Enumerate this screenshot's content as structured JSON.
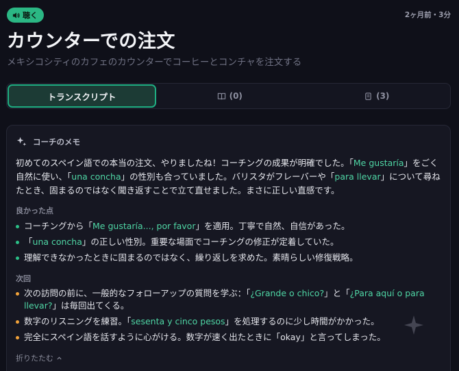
{
  "header": {
    "listen_label": "聴く",
    "meta": "2ヶ月前・3分",
    "title": "カウンターでの注文",
    "subtitle": "メキシコシティのカフェのカウンターでコーヒーとコンチャを注文する"
  },
  "tabs": [
    {
      "label": "トランスクリプト",
      "icon": "",
      "active": true
    },
    {
      "label": "(0)",
      "icon": "book-icon",
      "active": false
    },
    {
      "label": "(3)",
      "icon": "flashcards-icon",
      "active": false
    }
  ],
  "coach_note": {
    "heading": "コーチのメモ",
    "intro": {
      "p1": "初めてのスペイン語での本当の注文、やりましたね！コーチングの成果が明確でした。「",
      "h1": "Me gustaría",
      "p2": "」をごく自然に使い、「",
      "h2": "una concha",
      "p3": "」の性別も合っていました。バリスタがフレーバーや「",
      "h3": "para llevar",
      "p4": "」について尋ねたとき、固まるのではなく聞き返すことで立て直せました。まさに正しい直感です。"
    },
    "good_label": "良かった点",
    "good": [
      {
        "a": "コーチングから「",
        "h": "Me gustaría..., por favor",
        "b": "」を適用。丁寧で自然、自信があった。"
      },
      {
        "a": "「",
        "h": "una concha",
        "b": "」の正しい性別。重要な場面でコーチングの修正が定着していた。"
      },
      {
        "a": "理解できなかったときに固まるのではなく、繰り返しを求めた。素晴らしい修復戦略。",
        "h": "",
        "b": ""
      }
    ],
    "next_label": "次回",
    "next": [
      {
        "a": "次の訪問の前に、一般的なフォローアップの質問を学ぶ：「",
        "h": "¿Grande o chico?",
        "b": "」と「",
        "h2": "¿Para aquí o para llevar?",
        "c": "」は毎回出てくる。"
      },
      {
        "a": "数字のリスニングを練習。「",
        "h": "sesenta y cinco pesos",
        "b": "」を処理するのに少し時間がかかった。",
        "h2": "",
        "c": ""
      },
      {
        "a": "完全にスペイン語を話すように心がける。数字が速く出たときに「okay」と言ってしまった。",
        "h": "",
        "b": "",
        "h2": "",
        "c": ""
      }
    ],
    "collapse_label": "折りたたむ"
  },
  "colors": {
    "accent": "#2bb784",
    "highlight": "#4fd6a5",
    "bullet_good": "#2bbf87",
    "bullet_next": "#f2a33a",
    "background": "#0f1019"
  }
}
